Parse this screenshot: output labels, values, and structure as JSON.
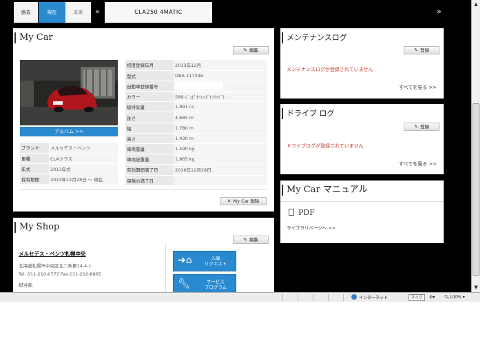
{
  "nav": {
    "past": "過去",
    "present": "現在",
    "future": "未来",
    "prev_glyph": "«",
    "next_glyph": "»",
    "car_title": "CLA250 4MATIC"
  },
  "mycar": {
    "title": "My Car",
    "edit_label": "編集",
    "album_label": "アルバム >>",
    "delete_label": "My Car 削除",
    "basic": [
      {
        "label": "ブランド",
        "value": "メルセデス・ベンツ"
      },
      {
        "label": "車種",
        "value": "CLAクラス"
      },
      {
        "label": "年式",
        "value": "2013年式"
      },
      {
        "label": "保有期間",
        "value": "2013年12月28日 〜 現在"
      }
    ],
    "specs": [
      {
        "label": "初度登録年月",
        "value": "2013年12月"
      },
      {
        "label": "型式",
        "value": "DBA-117346"
      },
      {
        "label": "自動車登録番号",
        "value": ""
      },
      {
        "label": "カラー",
        "value": "589-ｼﾞｭﾋﾟﾀｰﾚｯﾄﾞ(ｿﾘｯﾄﾞ)"
      },
      {
        "label": "総排気量",
        "value": "1,991 cc"
      },
      {
        "label": "長さ",
        "value": "4.685 m"
      },
      {
        "label": "幅",
        "value": "1.780 m"
      },
      {
        "label": "高さ",
        "value": "1.430 m"
      },
      {
        "label": "車両重量",
        "value": "1,590 kg"
      },
      {
        "label": "車両総重量",
        "value": "1,865 kg"
      },
      {
        "label": "有効期間満了日",
        "value": "2016年12月28日"
      },
      {
        "label": "保険の満了日",
        "value": "-"
      }
    ]
  },
  "maintenance": {
    "title": "メンテナンスログ",
    "register_label": "登録",
    "empty_message": "メンテナンスログが登録されていません",
    "see_all": "すべてを見る >>"
  },
  "drive": {
    "title": "ドライブ ログ",
    "register_label": "登録",
    "empty_message": "ドライブログが登録されていません",
    "see_all": "すべてを見る >>"
  },
  "manual": {
    "title": "My Car マニュアル",
    "pdf_label": "PDF",
    "library_link": "ライブラリページへ >>"
  },
  "shop": {
    "title": "My Shop",
    "edit_label": "編集",
    "name": "メルセデス・ベンツ札幌中央",
    "address": "北海道札幌市中央区北二条東14-4-1",
    "tel": "Tel. 011-210-0777 Fax.011-210-8865",
    "staff_label": "担当者:",
    "btn_request_l1": "入庫",
    "btn_request_l2": "リクエスト",
    "btn_service_l1": "サービス",
    "btn_service_l2": "プログラム"
  },
  "statusbar": {
    "zone": "インターネット",
    "ime": "マイク",
    "zoom": "100%"
  }
}
